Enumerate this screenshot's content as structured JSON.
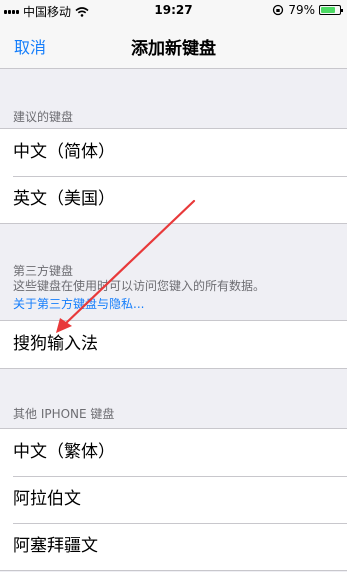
{
  "status_bar": {
    "carrier": "中国移动",
    "time": "19:27",
    "battery_percent": "79%",
    "battery_level": 0.79
  },
  "nav": {
    "cancel": "取消",
    "title": "添加新键盘"
  },
  "suggested": {
    "header": "建议的键盘",
    "items": [
      "中文（简体）",
      "英文（美国）"
    ]
  },
  "third_party": {
    "header": "第三方键盘",
    "description": "这些键盘在使用时可以访问您键入的所有数据。",
    "link": "关于第三方键盘与隐私...",
    "items": [
      "搜狗输入法"
    ]
  },
  "other": {
    "header": "其他 IPHONE 键盘",
    "items": [
      "中文（繁体）",
      "阿拉伯文",
      "阿塞拜疆文"
    ]
  },
  "colors": {
    "accent": "#157efb",
    "arrow": "#e8393a",
    "background": "#efeff4"
  }
}
